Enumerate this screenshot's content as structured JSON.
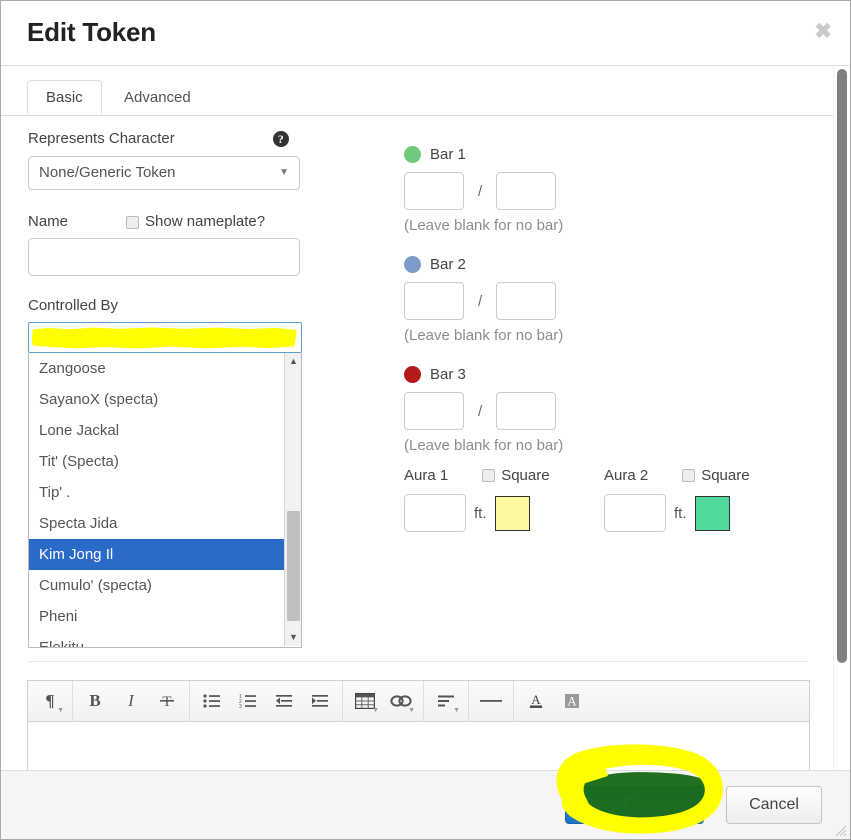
{
  "dialog": {
    "title": "Edit Token",
    "close_label": "✖"
  },
  "tabs": [
    {
      "label": "Basic",
      "active": true
    },
    {
      "label": "Advanced",
      "active": false
    }
  ],
  "left": {
    "represents_character": {
      "label": "Represents Character",
      "help_icon_text": "?",
      "selected_option": "None/Generic Token",
      "caret": "▼"
    },
    "name": {
      "label": "Name",
      "value": "",
      "placeholder": ""
    },
    "show_nameplate": {
      "label": "Show nameplate?",
      "checked": false
    },
    "controlled_by": {
      "label": "Controlled By",
      "value": "",
      "options": [
        "Zangoose",
        "SayanoX (specta)",
        "Lone Jackal",
        "Tit' (Specta)",
        "Tip' .",
        "Specta Jida",
        "Kim Jong Il",
        "Cumulo' (specta)",
        "Pheni",
        "Elekitu ."
      ],
      "selected_option": "Kim Jong Il",
      "scroll_up_arrow": "▲",
      "scroll_down_arrow": "▼"
    }
  },
  "right": {
    "bars": [
      {
        "title": "Bar 1",
        "color": "#71c97e",
        "current": "",
        "max": "",
        "separator": "/",
        "note": "(Leave blank for no bar)"
      },
      {
        "title": "Bar 2",
        "color": "#7b9bc9",
        "current": "",
        "max": "",
        "separator": "/",
        "note": "(Leave blank for no bar)"
      },
      {
        "title": "Bar 3",
        "color": "#b51a1a",
        "current": "",
        "max": "",
        "separator": "/",
        "note": "(Leave blank for no bar)"
      }
    ],
    "auras": [
      {
        "label": "Aura 1",
        "square_label": "Square",
        "square_checked": false,
        "radius": "",
        "unit": "ft.",
        "color": "#fcf9a0"
      },
      {
        "label": "Aura 2",
        "square_label": "Square",
        "square_checked": false,
        "radius": "",
        "unit": "ft.",
        "color": "#4fd99a"
      }
    ]
  },
  "editor": {
    "toolbar_groups": [
      {
        "buttons": [
          {
            "icon": "paragraph-format-icon",
            "glyph": "¶",
            "has_caret": true
          }
        ]
      },
      {
        "buttons": [
          {
            "icon": "bold-icon",
            "glyph": "B",
            "has_caret": false
          },
          {
            "icon": "italic-icon",
            "glyph": "I",
            "has_caret": false
          },
          {
            "icon": "strikethrough-icon",
            "glyph": "Ŧ",
            "has_caret": false
          }
        ]
      },
      {
        "buttons": [
          {
            "icon": "unordered-list-icon",
            "glyph": "",
            "has_caret": false
          },
          {
            "icon": "ordered-list-icon",
            "glyph": "",
            "has_caret": false
          },
          {
            "icon": "outdent-icon",
            "glyph": "",
            "has_caret": false
          },
          {
            "icon": "indent-icon",
            "glyph": "",
            "has_caret": false
          }
        ]
      },
      {
        "buttons": [
          {
            "icon": "insert-table-icon",
            "glyph": "",
            "has_caret": true
          },
          {
            "icon": "insert-link-icon",
            "glyph": "∞",
            "has_caret": true
          }
        ]
      },
      {
        "buttons": [
          {
            "icon": "align-text-icon",
            "glyph": "",
            "has_caret": true
          }
        ]
      },
      {
        "buttons": [
          {
            "icon": "horizontal-rule-icon",
            "glyph": "—",
            "has_caret": false
          }
        ]
      },
      {
        "buttons": [
          {
            "icon": "text-color-icon",
            "glyph": "A",
            "has_caret": false
          },
          {
            "icon": "text-background-color-icon",
            "glyph": "A",
            "has_caret": false
          }
        ]
      }
    ],
    "content": ""
  },
  "footer": {
    "save_label": "Save Changes",
    "cancel_label": "Cancel"
  },
  "annotations": {
    "highlight_color": "#ffff00",
    "blob_color": "#1a6b1a",
    "controlled_by_highlight": true,
    "save_button_circle": true
  }
}
